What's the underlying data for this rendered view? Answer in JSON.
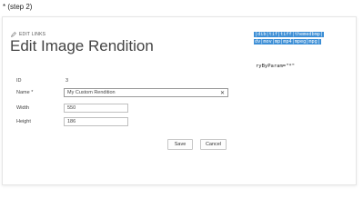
{
  "caption": "* (step 2)",
  "header": {
    "edit_links_label": "EDIT LINKS",
    "title": "Edit Image Rendition"
  },
  "form": {
    "id_label": "ID",
    "id_value": "3",
    "name_label": "Name *",
    "name_value": "My Custom Rendition",
    "width_label": "Width",
    "width_value": "550",
    "height_label": "Height",
    "height_value": "186"
  },
  "buttons": {
    "save_label": "Save",
    "cancel_label": "Cancel"
  },
  "code": {
    "line1": "|dib|tif|tiff|themedbmp|",
    "line2": "dv|mov|mp|mp4|mpeg|mpg|",
    "line3": "ryByParam=\"*\""
  },
  "colors": {
    "selection": "#3d8fd6",
    "border": "#bfbfbf"
  }
}
